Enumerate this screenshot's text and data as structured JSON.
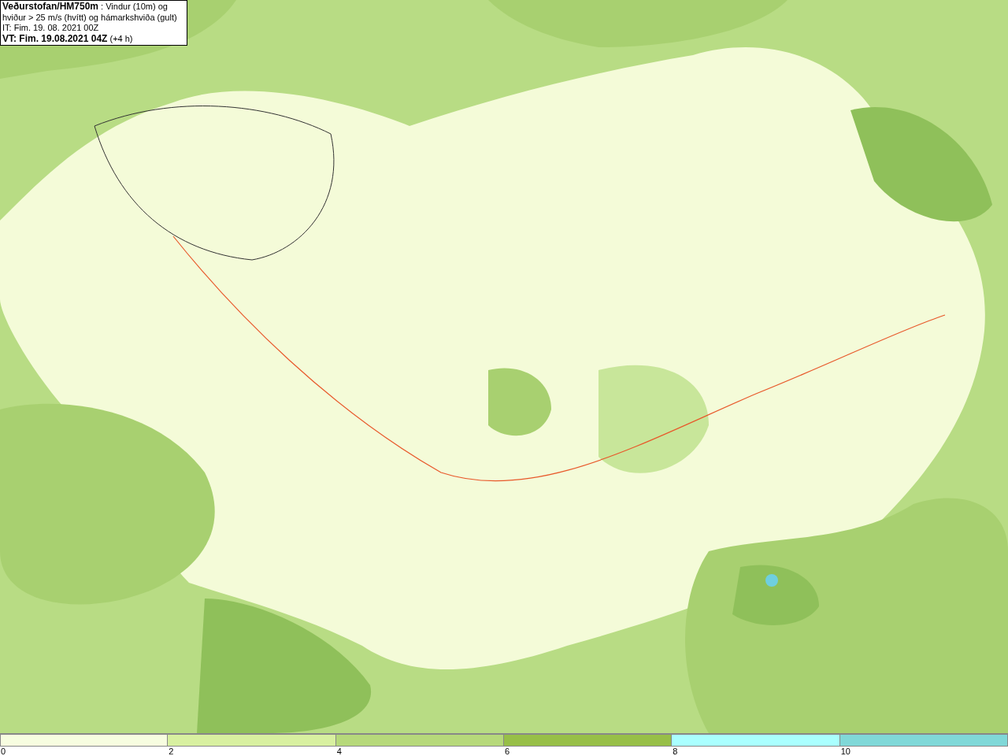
{
  "header": {
    "lines": [
      "**Veðurstofan/HM750m** : Vindur (10m) og hviður > 25 m/s (hvítt) og hámarkshviða (gult)",
      "IT: Fim. 19. 08. 2021 00Z",
      "**VT: Fim. 19.08.2021 04Z** (+4 h)"
    ]
  },
  "legend": [
    {
      "label": "0",
      "color": "#f7fde0"
    },
    {
      "label": "2",
      "color": "#d8f0a0"
    },
    {
      "label": "4",
      "color": "#b6d97a"
    },
    {
      "label": "6",
      "color": "#97bf47"
    },
    {
      "label": "8",
      "color": "#aaffff"
    },
    {
      "label": "10",
      "color": "#80d8d8"
    }
  ]
}
